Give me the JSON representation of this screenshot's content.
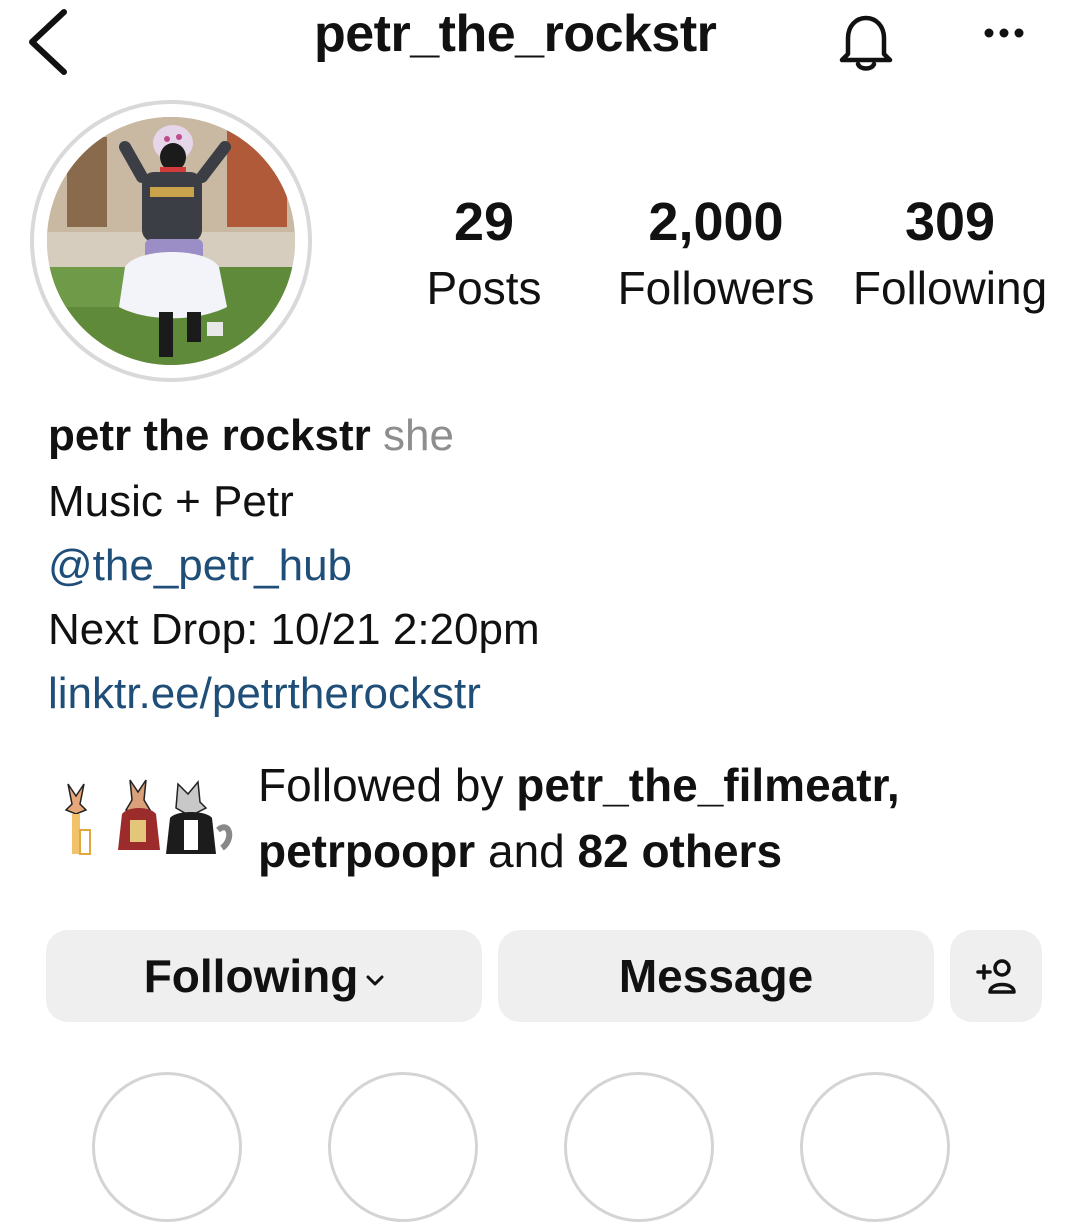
{
  "header": {
    "username": "petr_the_rockstr",
    "icons": [
      "back-chevron-icon",
      "bell-icon",
      "more-options-icon"
    ]
  },
  "stats": [
    {
      "value": "29",
      "label": "Posts"
    },
    {
      "value": "2,000",
      "label": "Followers"
    },
    {
      "value": "309",
      "label": "Following"
    }
  ],
  "bio": {
    "name": "petr the rockstr",
    "pronouns": "she",
    "line1": "Music + Petr",
    "mention": "@the_petr_hub",
    "line3": "Next Drop: 10/21 2:20pm",
    "link": "linktr.ee/petrtherockstr"
  },
  "followed_by": {
    "prefix": "Followed by",
    "user1": "petr_the_filmeatr,",
    "user2": "petrpoopr",
    "connector": "and",
    "others": "82 others"
  },
  "buttons": {
    "following": "Following",
    "message": "Message",
    "add_user_icon": "add-person-icon"
  },
  "colors": {
    "link": "#1f4e79",
    "button_bg": "#efefef",
    "secondary_text": "#8e8e8e"
  }
}
